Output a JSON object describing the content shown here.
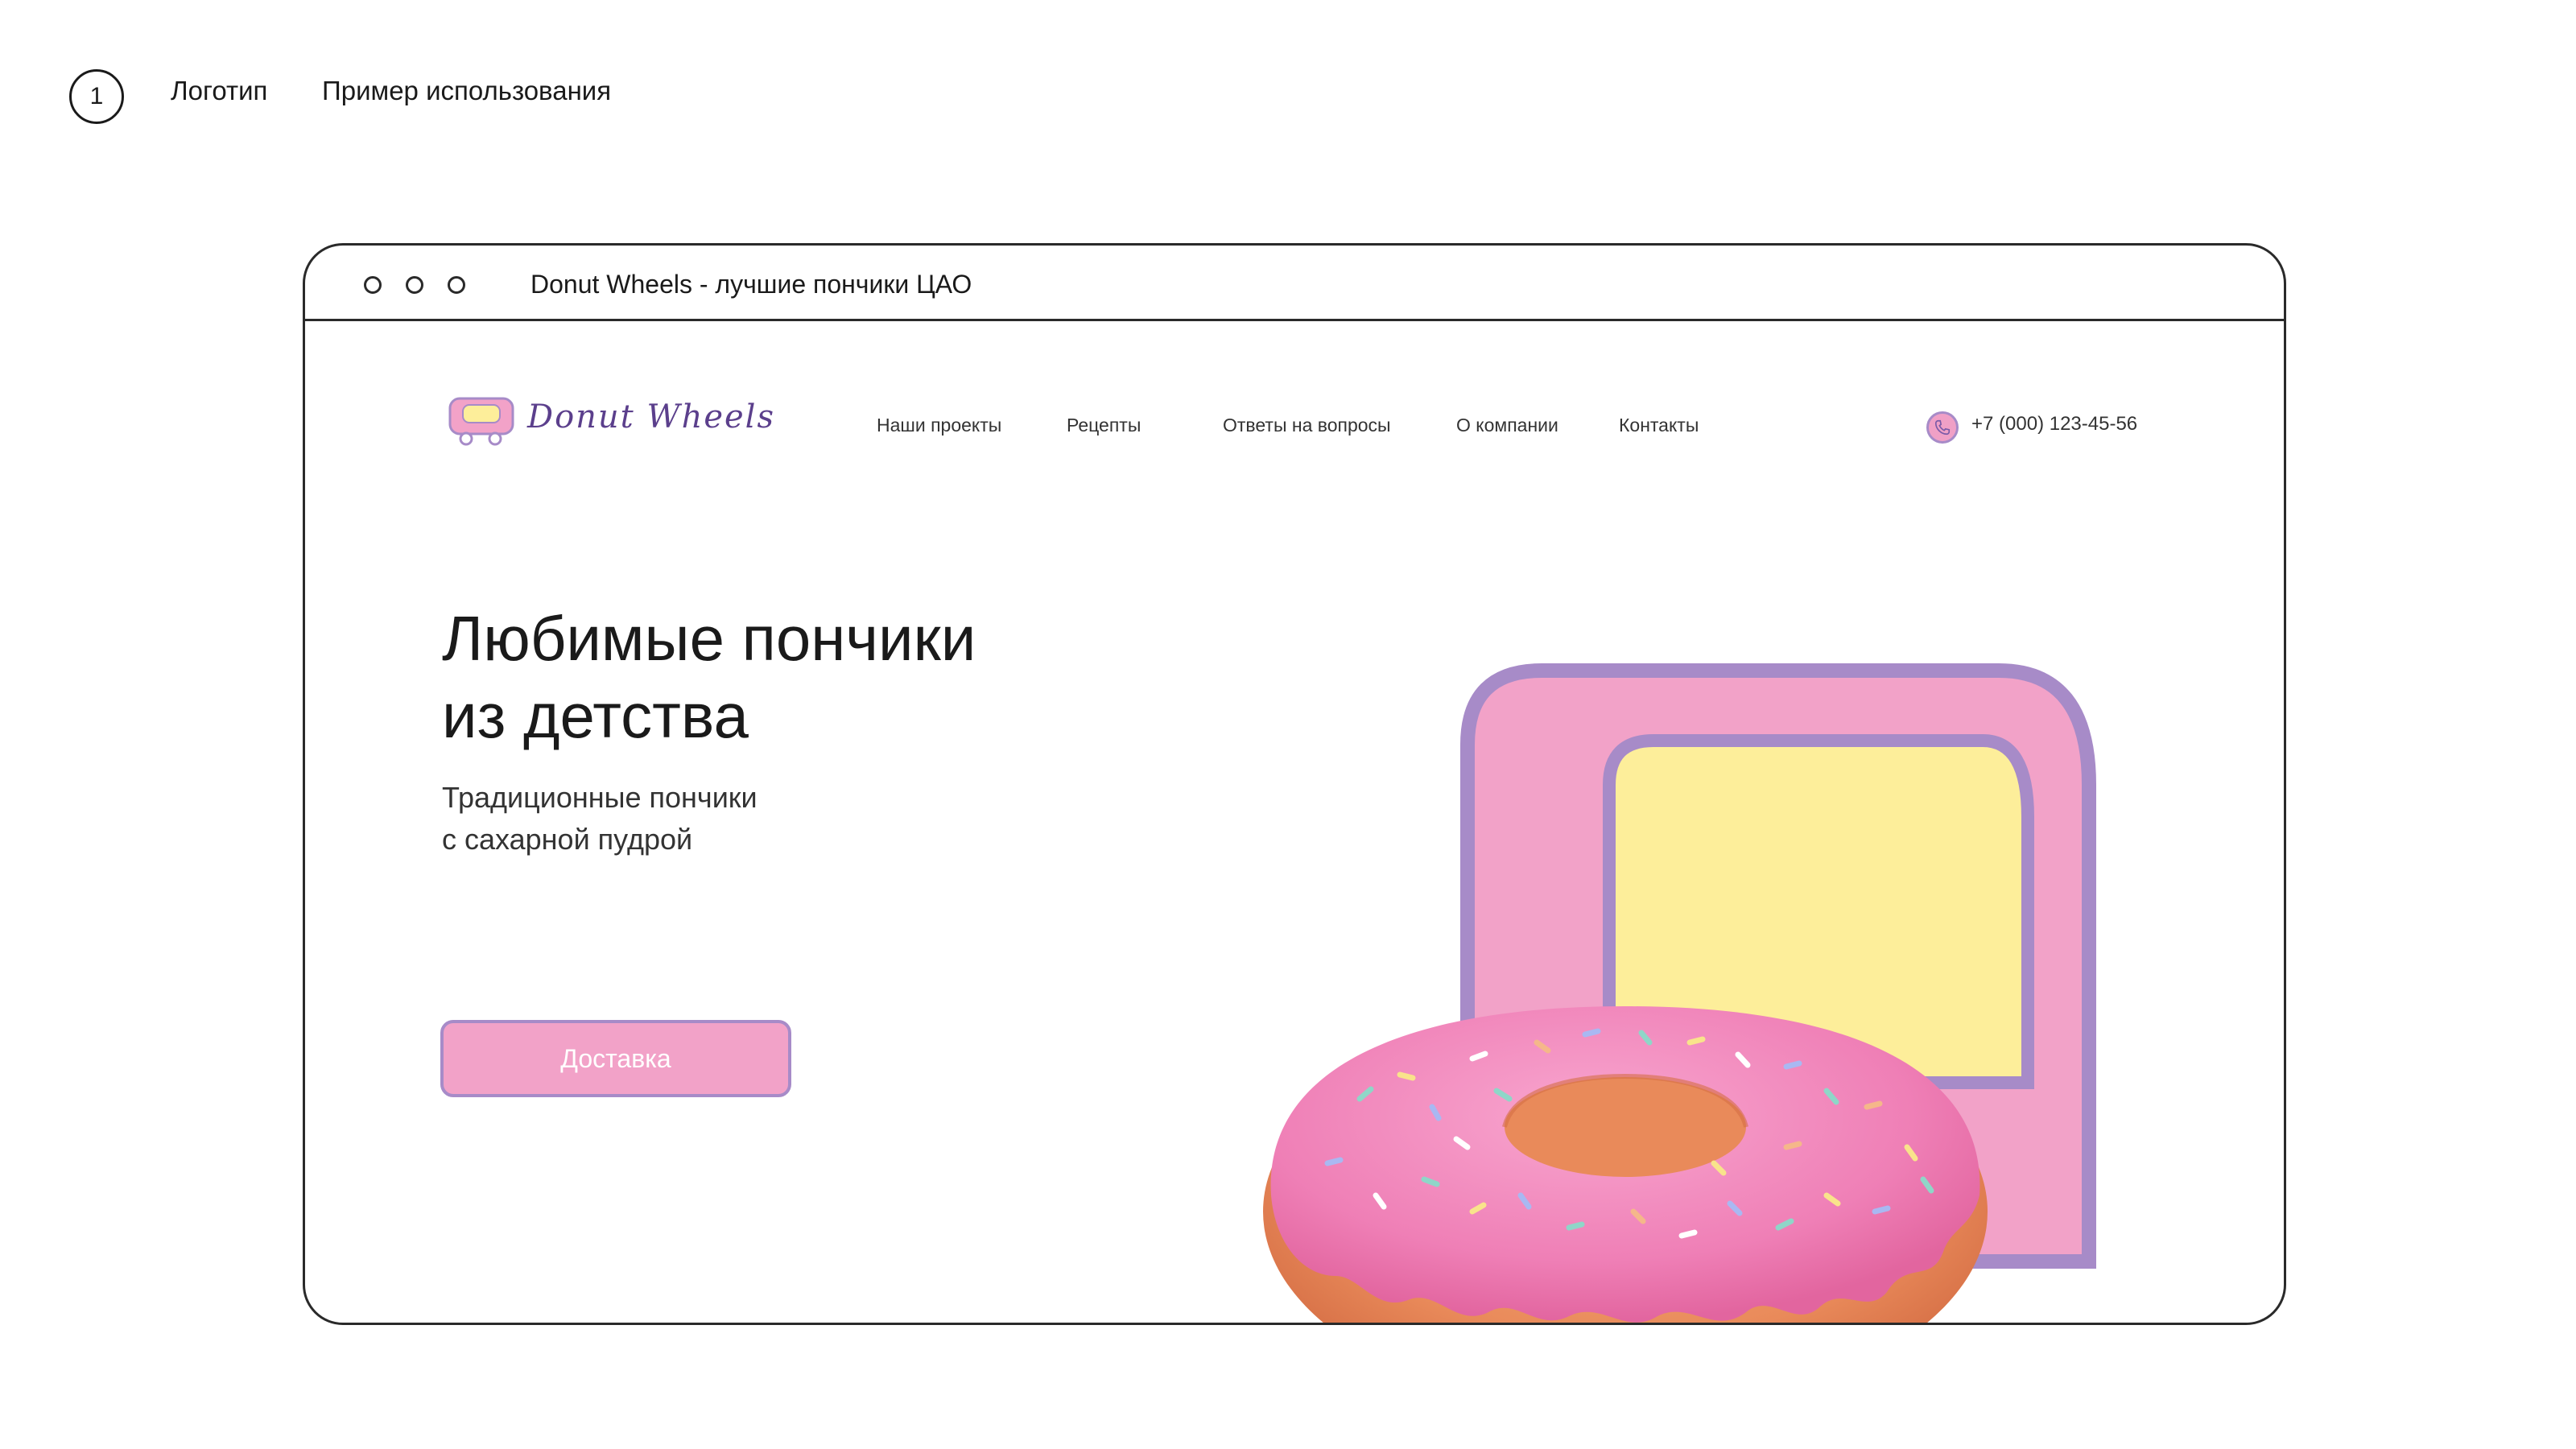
{
  "slide": {
    "number": "1",
    "section_label": "Логотип",
    "subsection_label": "Пример использования"
  },
  "browser": {
    "tab_title": "Donut Wheels - лучшие пончики ЦАО"
  },
  "site": {
    "logo_text": "Donut Wheels",
    "nav": [
      "Наши проекты",
      "Рецепты",
      "Ответы на вопросы",
      "О компании",
      "Контакты"
    ],
    "phone": "+7 (000) 123-45-56",
    "hero_title_line1": "Любимые пончики",
    "hero_title_line2": "из детства",
    "hero_subtitle_line1": "Традиционные пончики",
    "hero_subtitle_line2": "с сахарной пудрой",
    "cta_label": "Доставка"
  },
  "icons": {
    "logo": "donut-truck-logo-icon",
    "phone": "phone-icon",
    "hero_image": "donut-illustration"
  },
  "colors": {
    "pink": "#f2a2c8",
    "purple": "#a78bc8",
    "yellow": "#fdee9a",
    "logo_text": "#5b3f8c"
  }
}
